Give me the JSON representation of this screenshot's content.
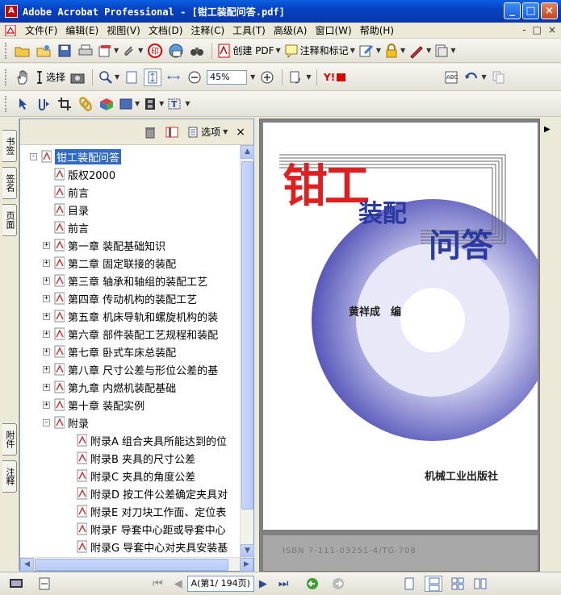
{
  "window": {
    "title": "Adobe Acrobat Professional - [钳工装配问答.pdf]",
    "min": "_",
    "max": "□",
    "close": "×"
  },
  "menu": [
    "文件(F)",
    "编辑(E)",
    "视图(V)",
    "文档(D)",
    "注释(C)",
    "工具(T)",
    "高级(A)",
    "窗口(W)",
    "帮助(H)"
  ],
  "mdi": [
    "-",
    "□",
    "×"
  ],
  "toolbar1": {
    "create_pdf": "创建 PDF",
    "comment": "注释和标记"
  },
  "toolbar2": {
    "select": "选择",
    "zoom": "45%"
  },
  "nav": {
    "options": "选项",
    "close": "×",
    "tabs_top": [
      "书签",
      "签名",
      "页面"
    ],
    "tabs_bottom": [
      "附件",
      "注释"
    ],
    "items": [
      {
        "label": "钳工装配问答",
        "exp": "⊟",
        "level": 0,
        "selected": true
      },
      {
        "label": "版权2000",
        "exp": "",
        "level": 1
      },
      {
        "label": "前言",
        "exp": "",
        "level": 1
      },
      {
        "label": "目录",
        "exp": "",
        "level": 1
      },
      {
        "label": "前言",
        "exp": "",
        "level": 1
      },
      {
        "label": "第一章 装配基础知识",
        "exp": "⊞",
        "level": 1
      },
      {
        "label": "第二章 固定联接的装配",
        "exp": "⊞",
        "level": 1
      },
      {
        "label": "第三章 轴承和轴组的装配工艺",
        "exp": "⊞",
        "level": 1
      },
      {
        "label": "第四章 传动机构的装配工艺",
        "exp": "⊞",
        "level": 1
      },
      {
        "label": "第五章 机床导轨和螺旋机构的装",
        "exp": "⊞",
        "level": 1
      },
      {
        "label": "第六章 部件装配工艺规程和装配",
        "exp": "⊞",
        "level": 1
      },
      {
        "label": "第七章 卧式车床总装配",
        "exp": "⊞",
        "level": 1
      },
      {
        "label": "第八章 尺寸公差与形位公差的基",
        "exp": "⊞",
        "level": 1
      },
      {
        "label": "第九章 内燃机装配基础",
        "exp": "⊞",
        "level": 1
      },
      {
        "label": "第十章 装配实例",
        "exp": "⊞",
        "level": 1
      },
      {
        "label": "附录",
        "exp": "⊟",
        "level": 1
      },
      {
        "label": "附录A 组合夹具所能达到的位",
        "exp": "",
        "level": 2
      },
      {
        "label": "附录B 夹具的尺寸公差",
        "exp": "",
        "level": 2
      },
      {
        "label": "附录C 夹具的角度公差",
        "exp": "",
        "level": 2
      },
      {
        "label": "附录D 按工件公差确定夹具对",
        "exp": "",
        "level": 2
      },
      {
        "label": "附录E 对刀块工作面、定位表",
        "exp": "",
        "level": 2
      },
      {
        "label": "附录F 导套中心距或导套中心",
        "exp": "",
        "level": 2
      },
      {
        "label": "附录G 导套中心对夹具安装基",
        "exp": "",
        "level": 2
      }
    ]
  },
  "cover": {
    "title_a": "钳工",
    "title_b": "装配",
    "title_c": "问答",
    "author": "黄祥成　编",
    "publisher": "机械工业出版社",
    "isbn": "ISBN 7-111-03251-4/TG·708"
  },
  "status": {
    "page_label": "A(第1/ 194页)"
  },
  "colors": {
    "titlebar": "#0841c4",
    "selection": "#316ac5",
    "title_red": "#e02020"
  }
}
